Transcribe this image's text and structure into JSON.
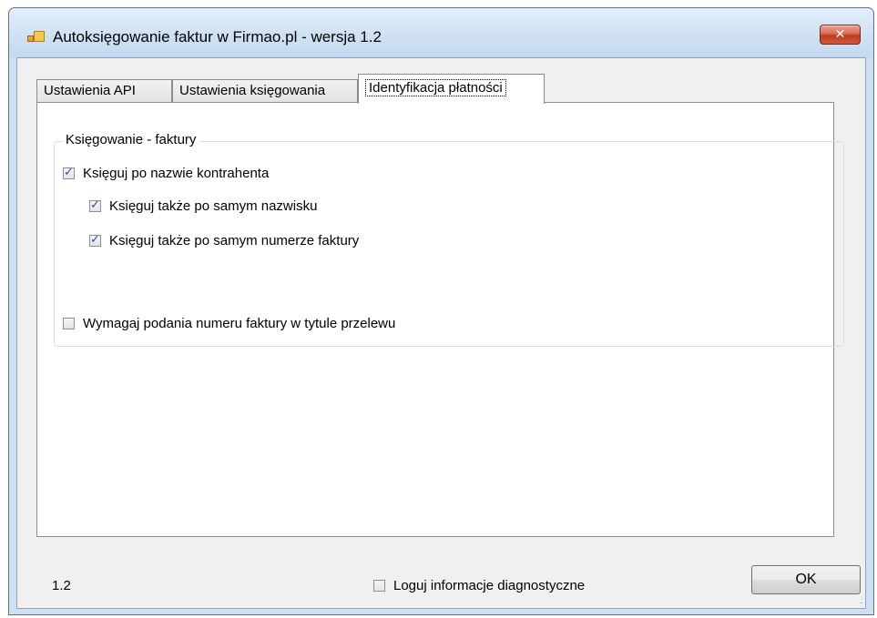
{
  "window": {
    "title": "Autoksięgowanie faktur w Firmao.pl - wersja 1.2",
    "close_label": "✕"
  },
  "tabs": [
    {
      "label": "Ustawienia API",
      "active": false
    },
    {
      "label": "Ustawienia księgowania",
      "active": false
    },
    {
      "label": "Identyfikacja płatności",
      "active": true
    }
  ],
  "group": {
    "legend": "Księgowanie - faktury",
    "options": [
      {
        "label": "Księguj po nazwie kontrahenta",
        "checked": true
      },
      {
        "label": "Księguj także po samym nazwisku",
        "checked": true
      },
      {
        "label": "Księguj także po samym numerze faktury",
        "checked": true
      },
      {
        "label": "Wymagaj podania numeru faktury w tytule przelewu",
        "checked": false
      }
    ]
  },
  "footer": {
    "version": "1.2",
    "diagnostics_label": "Loguj informacje diagnostyczne",
    "diagnostics_checked": false,
    "ok_label": "OK"
  },
  "colors": {
    "window_frame": "#cfe0f1",
    "close_button": "#c0391d"
  }
}
